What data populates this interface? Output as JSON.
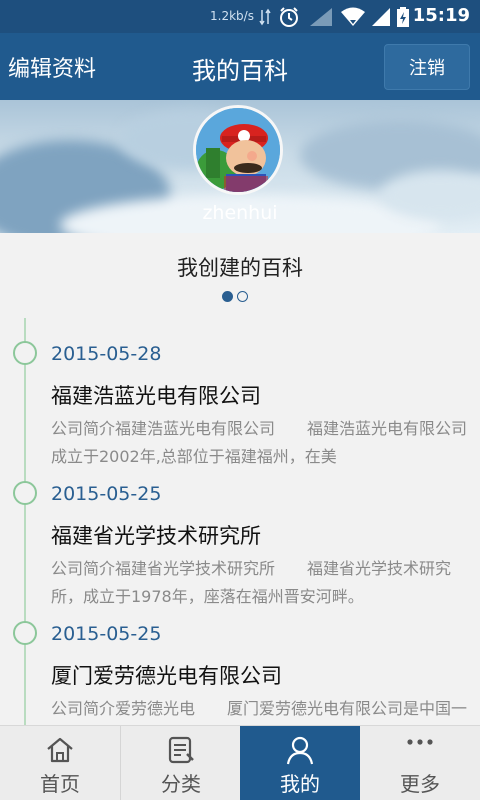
{
  "status_bar": {
    "speed": "1.2kb/s",
    "time": "15:19"
  },
  "header": {
    "edit_label": "编辑资料",
    "title": "我的百科",
    "logout_label": "注销"
  },
  "profile": {
    "username": "zhenhui"
  },
  "section": {
    "title": "我创建的百科",
    "pager": {
      "count": 2,
      "active": 1
    }
  },
  "entries": [
    {
      "date": "2015-05-28",
      "name": "福建浩蓝光电有限公司",
      "desc": "公司简介福建浩蓝光电有限公司　　福建浩蓝光电有限公司成立于2002年,总部位于福建福州，在美"
    },
    {
      "date": "2015-05-25",
      "name": "福建省光学技术研究所",
      "desc": "公司简介福建省光学技术研究所　　福建省光学技术研究所，成立于1978年，座落在福州晋安河畔。"
    },
    {
      "date": "2015-05-25",
      "name": "厦门爱劳德光电有限公司",
      "desc": "公司简介爱劳德光电　　厦门爱劳德光电有限公司是中国一家专业从事光学镜头和光学部件生产的厂"
    }
  ],
  "nav": {
    "items": [
      {
        "label": "首页",
        "icon": "home-icon"
      },
      {
        "label": "分类",
        "icon": "category-list-icon"
      },
      {
        "label": "我的",
        "icon": "user-icon"
      },
      {
        "label": "更多",
        "icon": "more-dots-icon"
      }
    ],
    "active_index": 2
  },
  "colors": {
    "header": "#205a8e",
    "status_bar": "#1e4f7e",
    "accent": "#2a5f91",
    "timeline": "#8cc79a"
  }
}
